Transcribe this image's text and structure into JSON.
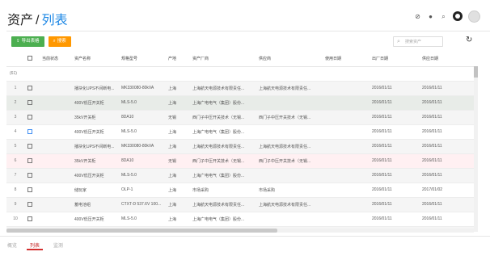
{
  "header": {
    "title": "资产",
    "separator": "/",
    "subtitle": "列表",
    "icons": [
      "help-icon",
      "chat-icon",
      "search-icon",
      "settings-icon"
    ]
  },
  "toolbar": {
    "export_label": "导出表格",
    "export_icon": "⇪",
    "search_label": "搜索",
    "search_icon": "⌕"
  },
  "search": {
    "placeholder": "搜索资产",
    "icon": "⌕"
  },
  "refresh": {
    "icon": "↻"
  },
  "table": {
    "columns": [
      "",
      "",
      "当前状态",
      "资产名称",
      "规格型号",
      "产地",
      "资产厂商",
      "供应商",
      "使用日期",
      "出厂日期",
      "供应日期"
    ],
    "filter_count": "(61)",
    "rows": [
      {
        "num": "1",
        "status": "",
        "name": "播块化UPS不间断电...",
        "model": "MK330080-80kVA",
        "origin": "上海",
        "vendor": "上海航天电源技术有限责任...",
        "supplier": "上海航天电源技术有限责任...",
        "use_date": "",
        "factory_date": "2016/01/11",
        "supply_date": "2016/01/11"
      },
      {
        "num": "2",
        "status": "",
        "name": "400V低压开关柜",
        "model": "MLS-5.0",
        "origin": "上海",
        "vendor": "上海广电电气（集团）股份...",
        "supplier": "",
        "use_date": "",
        "factory_date": "2016/01/11",
        "supply_date": "2016/01/11"
      },
      {
        "num": "3",
        "status": "",
        "name": "35kV开关柜",
        "model": "8DA10",
        "origin": "无锡",
        "vendor": "西门子中压开关技术（无锡...",
        "supplier": "西门子中压开关技术（无锡...",
        "use_date": "",
        "factory_date": "2016/01/11",
        "supply_date": "2016/01/11"
      },
      {
        "num": "4",
        "status": "",
        "name": "400V低压开关柜",
        "model": "MLS-5.0",
        "origin": "上海",
        "vendor": "上海广电电气（集团）股份...",
        "supplier": "",
        "use_date": "",
        "factory_date": "2016/01/11",
        "supply_date": "2016/01/11"
      },
      {
        "num": "5",
        "status": "",
        "name": "播块化UPS不间断电...",
        "model": "MK330080-80kVA",
        "origin": "上海",
        "vendor": "上海航天电源技术有限责任...",
        "supplier": "上海航天电源技术有限责任...",
        "use_date": "",
        "factory_date": "2016/01/11",
        "supply_date": "2016/01/11"
      },
      {
        "num": "6",
        "status": "",
        "name": "35kV开关柜",
        "model": "8DA10",
        "origin": "无锡",
        "vendor": "西门子中压开关技术（无锡...",
        "supplier": "西门子中压开关技术（无锡...",
        "use_date": "",
        "factory_date": "2016/01/11",
        "supply_date": "2016/01/11"
      },
      {
        "num": "7",
        "status": "",
        "name": "400V低压开关柜",
        "model": "MLS-5.0",
        "origin": "上海",
        "vendor": "上海广电电气（集团）股份...",
        "supplier": "",
        "use_date": "",
        "factory_date": "2016/01/11",
        "supply_date": "2016/01/11"
      },
      {
        "num": "8",
        "status": "",
        "name": "储玩家",
        "model": "OLP-1",
        "origin": "上海",
        "vendor": "市场采购",
        "supplier": "市场采购",
        "use_date": "",
        "factory_date": "2016/01/11",
        "supply_date": "2017/01/02"
      },
      {
        "num": "9",
        "status": "",
        "name": "蓄电池组",
        "model": "CTXT-D 537.6V 100...",
        "origin": "上海",
        "vendor": "上海航天电源技术有限责任...",
        "supplier": "上海航天电源技术有限责任...",
        "use_date": "",
        "factory_date": "2016/01/11",
        "supply_date": "2016/01/11"
      },
      {
        "num": "10",
        "status": "",
        "name": "400V低压开关柜",
        "model": "MLS-5.0",
        "origin": "上海",
        "vendor": "上海广电电气（集团）股份...",
        "supplier": "",
        "use_date": "",
        "factory_date": "2016/01/11",
        "supply_date": "2016/01/11"
      },
      {
        "num": "11",
        "status": "",
        "name": "400V低压开关柜",
        "model": "MLS-5.0",
        "origin": "上海",
        "vendor": "上海广电电气（集团）股份...",
        "supplier": "",
        "use_date": "",
        "factory_date": "2016/01/11",
        "supply_date": "2016/01/11"
      }
    ]
  },
  "bottom_tabs": [
    {
      "label": "概览",
      "active": false
    },
    {
      "label": "列表",
      "active": true
    },
    {
      "label": "监测",
      "active": false
    }
  ],
  "colors": {
    "accent": "#1e88e5",
    "export_button": "#4caf50",
    "search_button": "#ff9800",
    "active_tab": "#c62828"
  }
}
